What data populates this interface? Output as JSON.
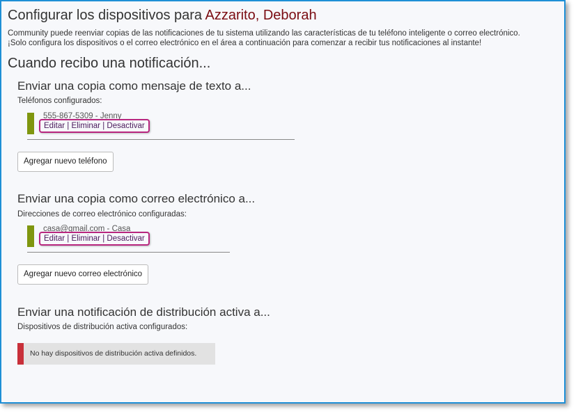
{
  "header": {
    "title_prefix": "Configurar los dispositivos para",
    "user_name": "Azzarito, Deborah",
    "intro_line1": "Community puede reenviar copias de las notificaciones de tu sistema utilizando las características de tu teléfono inteligente o correo electrónico.",
    "intro_line2": "¡Solo configura los dispositivos o el correo electrónico en el área a continuación para comenzar a recibir tus notificaciones al instante!"
  },
  "when_heading": "Cuando recibo una notificación...",
  "sms": {
    "title": "Enviar una copia como mensaje de texto a...",
    "subtitle": "Teléfonos configurados:",
    "devices": [
      {
        "name": "555-867-5309 - Jenny",
        "status_color": "#7f960f",
        "edit": "Editar",
        "delete": "Eliminar",
        "deactivate": "Desactivar"
      }
    ],
    "add_button": "Agregar nuevo teléfono"
  },
  "email": {
    "title": "Enviar una copia como correo electrónico a...",
    "subtitle": "Direcciones de correo electrónico configuradas:",
    "devices": [
      {
        "name": "casa@gmail.com - Casa",
        "status_color": "#7f960f",
        "edit": "Editar",
        "delete": "Eliminar",
        "deactivate": "Desactivar"
      }
    ],
    "add_button": "Agregar nuevo correo electrónico"
  },
  "push": {
    "title": "Enviar una notificación de distribución activa a...",
    "subtitle": "Dispositivos de distribución activa configurados:",
    "empty_message": "No hay dispositivos de distribución activa definidos.",
    "empty_accent_color": "#c8303a"
  },
  "colors": {
    "user_name": "#7a0c12",
    "highlight_border": "#b8267f",
    "frame_border": "#1e8fd6"
  },
  "action_separator": "|"
}
